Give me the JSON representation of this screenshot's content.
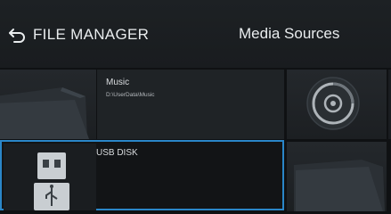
{
  "header": {
    "back_label": "FILE MANAGER",
    "section_title": "Media Sources"
  },
  "sources": [
    {
      "name": "Music",
      "path": "D:\\UserData\\Music",
      "icon": "folder-icon"
    },
    {
      "name": "",
      "path": "",
      "icon": "audio-disc-icon"
    },
    {
      "name": "USB DISK",
      "path": "",
      "icon": "usb-drive-icon",
      "selected": true
    },
    {
      "name": "",
      "path": "",
      "icon": "folder-icon"
    }
  ],
  "colors": {
    "selection_border": "#2a86c8",
    "background": "#16191c",
    "text": "#e6e8ea"
  }
}
